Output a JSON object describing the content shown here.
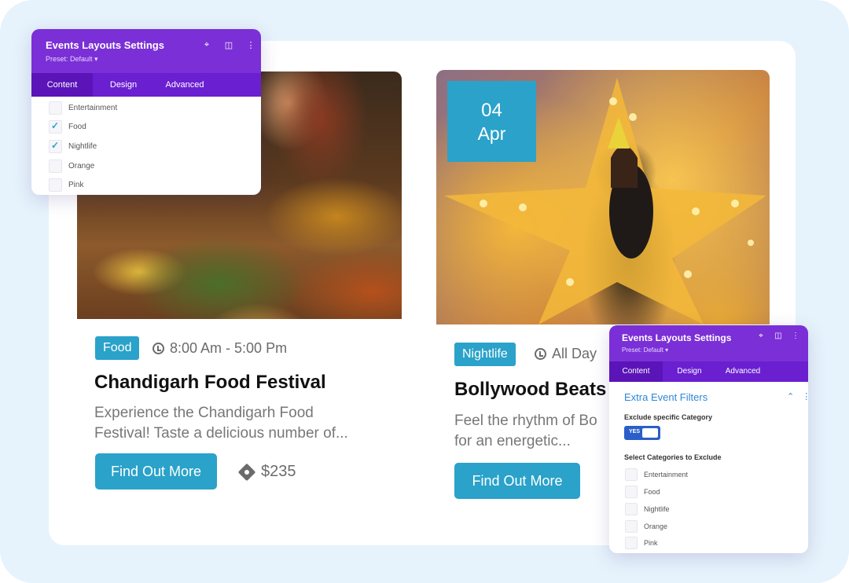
{
  "colors": {
    "accent": "#2aa2c9",
    "panel_purple": "#7b2fd6",
    "tab_bar": "#6a1fd0"
  },
  "events": [
    {
      "category": "Food",
      "time": "8:00 Am - 5:00 Pm",
      "title": "Chandigarh Food Festival",
      "desc_line1": "Experience the Chandigarh Food",
      "desc_line2": "Festival! Taste a delicious number of...",
      "button": "Find Out More",
      "price": "$235"
    },
    {
      "date_day": "04",
      "date_month": "Apr",
      "category": "Nightlife",
      "time": "All Day",
      "title": "Bollywood Beats",
      "desc_line1": "Feel the rhythm of Bo",
      "desc_line2": "for an energetic...",
      "button": "Find Out More"
    }
  ],
  "panel1": {
    "title": "Events Layouts Settings",
    "preset": "Preset: Default ▾",
    "icons": [
      "focus-icon",
      "sidebar-icon",
      "more-icon"
    ],
    "tabs": [
      "Content",
      "Design",
      "Advanced"
    ],
    "options": [
      {
        "label": "Entertainment",
        "checked": false
      },
      {
        "label": "Food",
        "checked": true
      },
      {
        "label": "Nightlife",
        "checked": true
      },
      {
        "label": "Orange",
        "checked": false
      },
      {
        "label": "Pink",
        "checked": false
      }
    ]
  },
  "panel2": {
    "title": "Events Layouts Settings",
    "preset": "Preset: Default ▾",
    "icons": [
      "focus-icon",
      "sidebar-icon",
      "more-icon"
    ],
    "tabs": [
      "Content",
      "Design",
      "Advanced"
    ],
    "section": "Extra Event Filters",
    "exclude_label": "Exclude specific Category",
    "toggle_value": "YES",
    "select_label": "Select Categories to Exclude",
    "options": [
      {
        "label": "Entertainment",
        "checked": false
      },
      {
        "label": "Food",
        "checked": false
      },
      {
        "label": "Nightlife",
        "checked": false
      },
      {
        "label": "Orange",
        "checked": false
      },
      {
        "label": "Pink",
        "checked": false
      }
    ]
  }
}
